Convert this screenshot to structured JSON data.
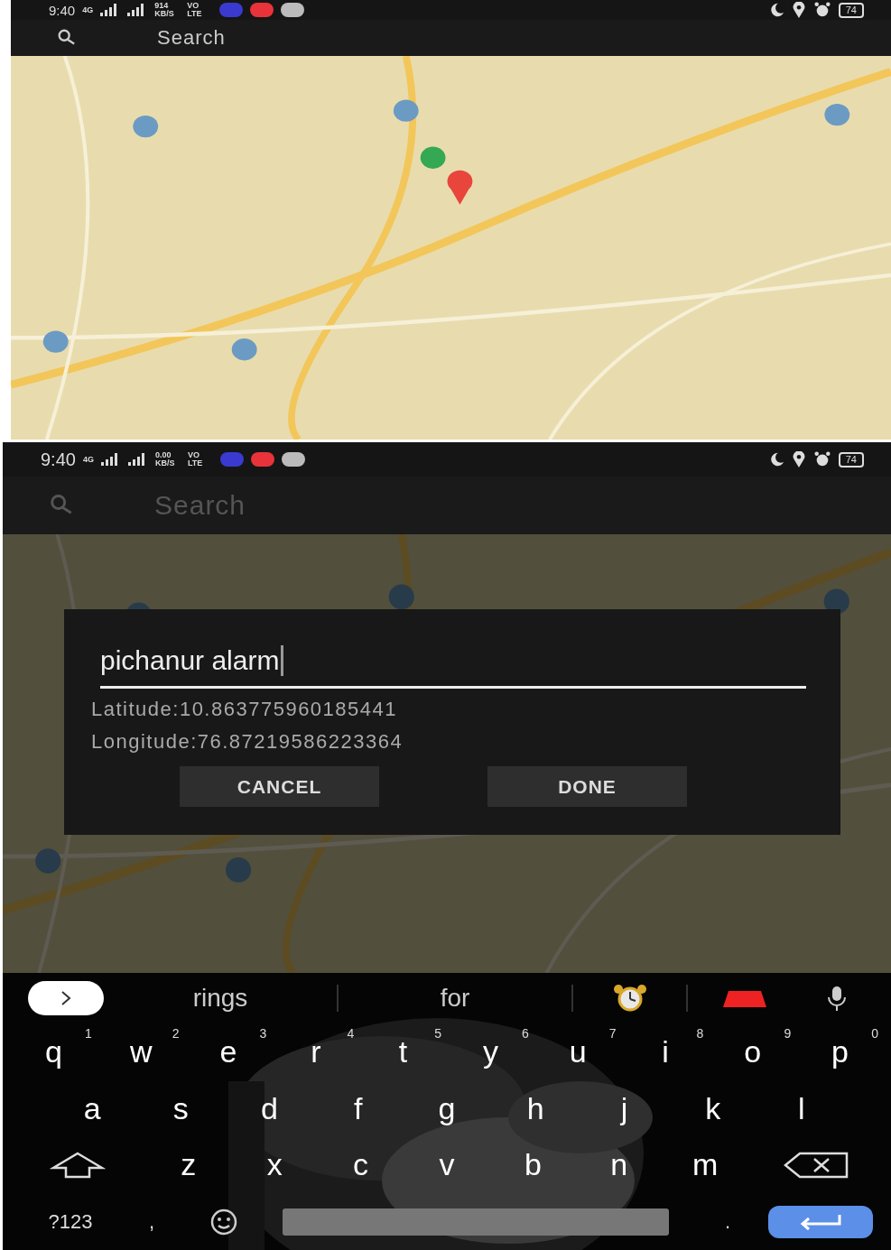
{
  "screens": [
    {
      "status_bar": {
        "time": "9:40",
        "network": "4G",
        "speed": "914 KB/S",
        "volte": "VO LTE",
        "battery": "74"
      },
      "search": {
        "placeholder": "Search"
      },
      "map": {
        "kind": "picture",
        "dimmed": false
      }
    },
    {
      "status_bar": {
        "time": "9:40",
        "network": "4G",
        "speed": "0.00 KB/S",
        "volte": "VO LTE",
        "battery": "74"
      },
      "search": {
        "placeholder": "Search"
      },
      "map": {
        "kind": "picture",
        "dimmed": true
      },
      "dialog": {
        "value": "pichanur alarm",
        "latitude": "Latitude:10.863775960185441",
        "longitude": "Longitude:76.87219586223364",
        "buttons": [
          "CANCEL",
          "DONE"
        ]
      },
      "keyboard": {
        "suggestions": [
          "rings",
          "for"
        ],
        "rows": [
          [
            {
              "key": "q",
              "hint": "1"
            },
            {
              "key": "w",
              "hint": "2"
            },
            {
              "key": "e",
              "hint": "3"
            },
            {
              "key": "r",
              "hint": "4"
            },
            {
              "key": "t",
              "hint": "5"
            },
            {
              "key": "y",
              "hint": "6"
            },
            {
              "key": "u",
              "hint": "7"
            },
            {
              "key": "i",
              "hint": "8"
            },
            {
              "key": "o",
              "hint": "9"
            },
            {
              "key": "p",
              "hint": "0"
            }
          ],
          [
            {
              "key": "a"
            },
            {
              "key": "s"
            },
            {
              "key": "d"
            },
            {
              "key": "f"
            },
            {
              "key": "g"
            },
            {
              "key": "h"
            },
            {
              "key": "j"
            },
            {
              "key": "k"
            },
            {
              "key": "l"
            }
          ],
          [
            {
              "key": "z"
            },
            {
              "key": "x"
            },
            {
              "key": "c"
            },
            {
              "key": "v"
            },
            {
              "key": "b"
            },
            {
              "key": "n"
            },
            {
              "key": "m"
            }
          ]
        ],
        "symbols": "?123",
        "comma": ",",
        "period": "."
      }
    }
  ]
}
